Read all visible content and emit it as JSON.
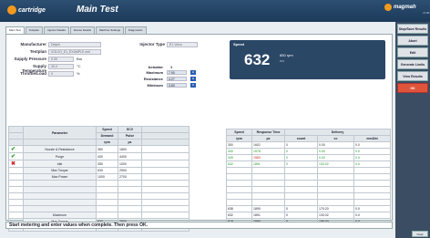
{
  "app": {
    "brand": "cartridge",
    "title": "Main Test",
    "right_brand": "magmah",
    "version": "v1.00"
  },
  "tabs": [
    "Main Test",
    "Testplan",
    "Injector Details",
    "Device Details",
    "Machine Settings",
    "Diagnostics"
  ],
  "form": {
    "manufacturer": {
      "label": "Manufacturer",
      "value": "Delphi"
    },
    "testplan": {
      "label": "Testplan",
      "value": "VOLVO_E1_EXAMPLE.xml"
    },
    "supply_pressure": {
      "label": "Supply Pressure",
      "value": "0.00",
      "unit": "Bar"
    },
    "supply_temperature": {
      "label": "Supply Temperature",
      "value": "40.0",
      "unit": "°C"
    },
    "throttle": {
      "label": "Throttle/Load",
      "value": "0",
      "unit": "%"
    },
    "injector_type": {
      "label": "Injector Type",
      "value": "E1 Volvo"
    }
  },
  "actuator": {
    "header_label": "Actuator",
    "header_value": "1",
    "rows": [
      {
        "label": "Maximum",
        "value": "7.90"
      },
      {
        "label": "Resistance",
        "value": "4.27"
      },
      {
        "label": "Minimum",
        "value": "3.80"
      }
    ]
  },
  "speed": {
    "label": "Speed",
    "value": "632",
    "unit": "650 rpm",
    "sub": "672"
  },
  "left_table": {
    "headers": [
      "Parameter",
      "Speed",
      "SCV"
    ],
    "subheaders": [
      "Demand",
      "Pulse"
    ],
    "units": [
      "rpm",
      "µs"
    ],
    "rows": [
      {
        "status": "check",
        "name": "Nozzle & Resistance",
        "speed": "350",
        "scv": "1800"
      },
      {
        "status": "check",
        "name": "Purge",
        "speed": "400",
        "scv": "4400"
      },
      {
        "status": "cross",
        "name": "Idle",
        "speed": "350",
        "scv": "1000"
      },
      {
        "status": "",
        "name": "Max Torque",
        "speed": "633",
        "scv": "2500"
      },
      {
        "status": "",
        "name": "Max Power",
        "speed": "1000",
        "scv": "2700"
      },
      {
        "status": "",
        "name": "",
        "speed": "",
        "scv": ""
      },
      {
        "status": "",
        "name": "",
        "speed": "",
        "scv": ""
      },
      {
        "status": "",
        "name": "",
        "speed": "",
        "scv": ""
      },
      {
        "status": "",
        "name": "",
        "speed": "",
        "scv": ""
      },
      {
        "status": "",
        "name": "",
        "speed": "",
        "scv": ""
      }
    ],
    "footer": [
      {
        "name": "Maximum",
        "speed": "",
        "scv": ""
      },
      {
        "name": "Max Torque",
        "speed": "633",
        "scv": "2500"
      },
      {
        "name": "Minimum",
        "speed": "",
        "scv": ""
      }
    ]
  },
  "right_table": {
    "headers": [
      "Speed",
      "Response Time",
      "Delivery"
    ],
    "subheaders": [
      "rpm",
      "µs",
      "count",
      "cc",
      "mm3/st"
    ],
    "rows": [
      {
        "speed": "350",
        "resp": "1602",
        "count": "0",
        "cc": "0.00",
        "mm": "0.0",
        "color": "#333"
      },
      {
        "speed": "400",
        "resp": "1578",
        "count": "0",
        "cc": "0.00",
        "mm": "0.0",
        "color": "#1e9a2a"
      },
      {
        "speed": "349",
        "resp": "1580",
        "count": "0",
        "cc": "0.02",
        "mm": "0.0",
        "color": "#1e9a2a"
      },
      {
        "speed": "632",
        "resp": "1891",
        "count": "0",
        "cc": "133.02",
        "mm": "0.0",
        "color": "#1e9a2a"
      },
      {
        "speed": "",
        "resp": "",
        "count": "",
        "cc": "",
        "mm": "",
        "color": "#333"
      },
      {
        "speed": "",
        "resp": "",
        "count": "",
        "cc": "",
        "mm": "",
        "color": "#333"
      },
      {
        "speed": "",
        "resp": "",
        "count": "",
        "cc": "",
        "mm": "",
        "color": "#333"
      },
      {
        "speed": "",
        "resp": "",
        "count": "",
        "cc": "",
        "mm": "",
        "color": "#333"
      },
      {
        "speed": "",
        "resp": "",
        "count": "",
        "cc": "",
        "mm": "",
        "color": "#333"
      },
      {
        "speed": "",
        "resp": "",
        "count": "",
        "cc": "",
        "mm": "",
        "color": "#333"
      }
    ],
    "footer": [
      {
        "speed": "638",
        "resp": "1890",
        "count": "0",
        "cc": "170.20",
        "mm": "0.0"
      },
      {
        "speed": "632",
        "resp": "1891",
        "count": "0",
        "cc": "133.02",
        "mm": "0.0"
      },
      {
        "speed": "618",
        "resp": "1590",
        "count": "0",
        "cc": "159.00",
        "mm": "0.0"
      }
    ]
  },
  "status": "Start metering and enter values when complete. Then press OK.",
  "sidebar": [
    "Stop/Save Results",
    "Abort",
    "Edit",
    "Generate Limits",
    "View Results",
    "OK"
  ],
  "clear": "Clear"
}
